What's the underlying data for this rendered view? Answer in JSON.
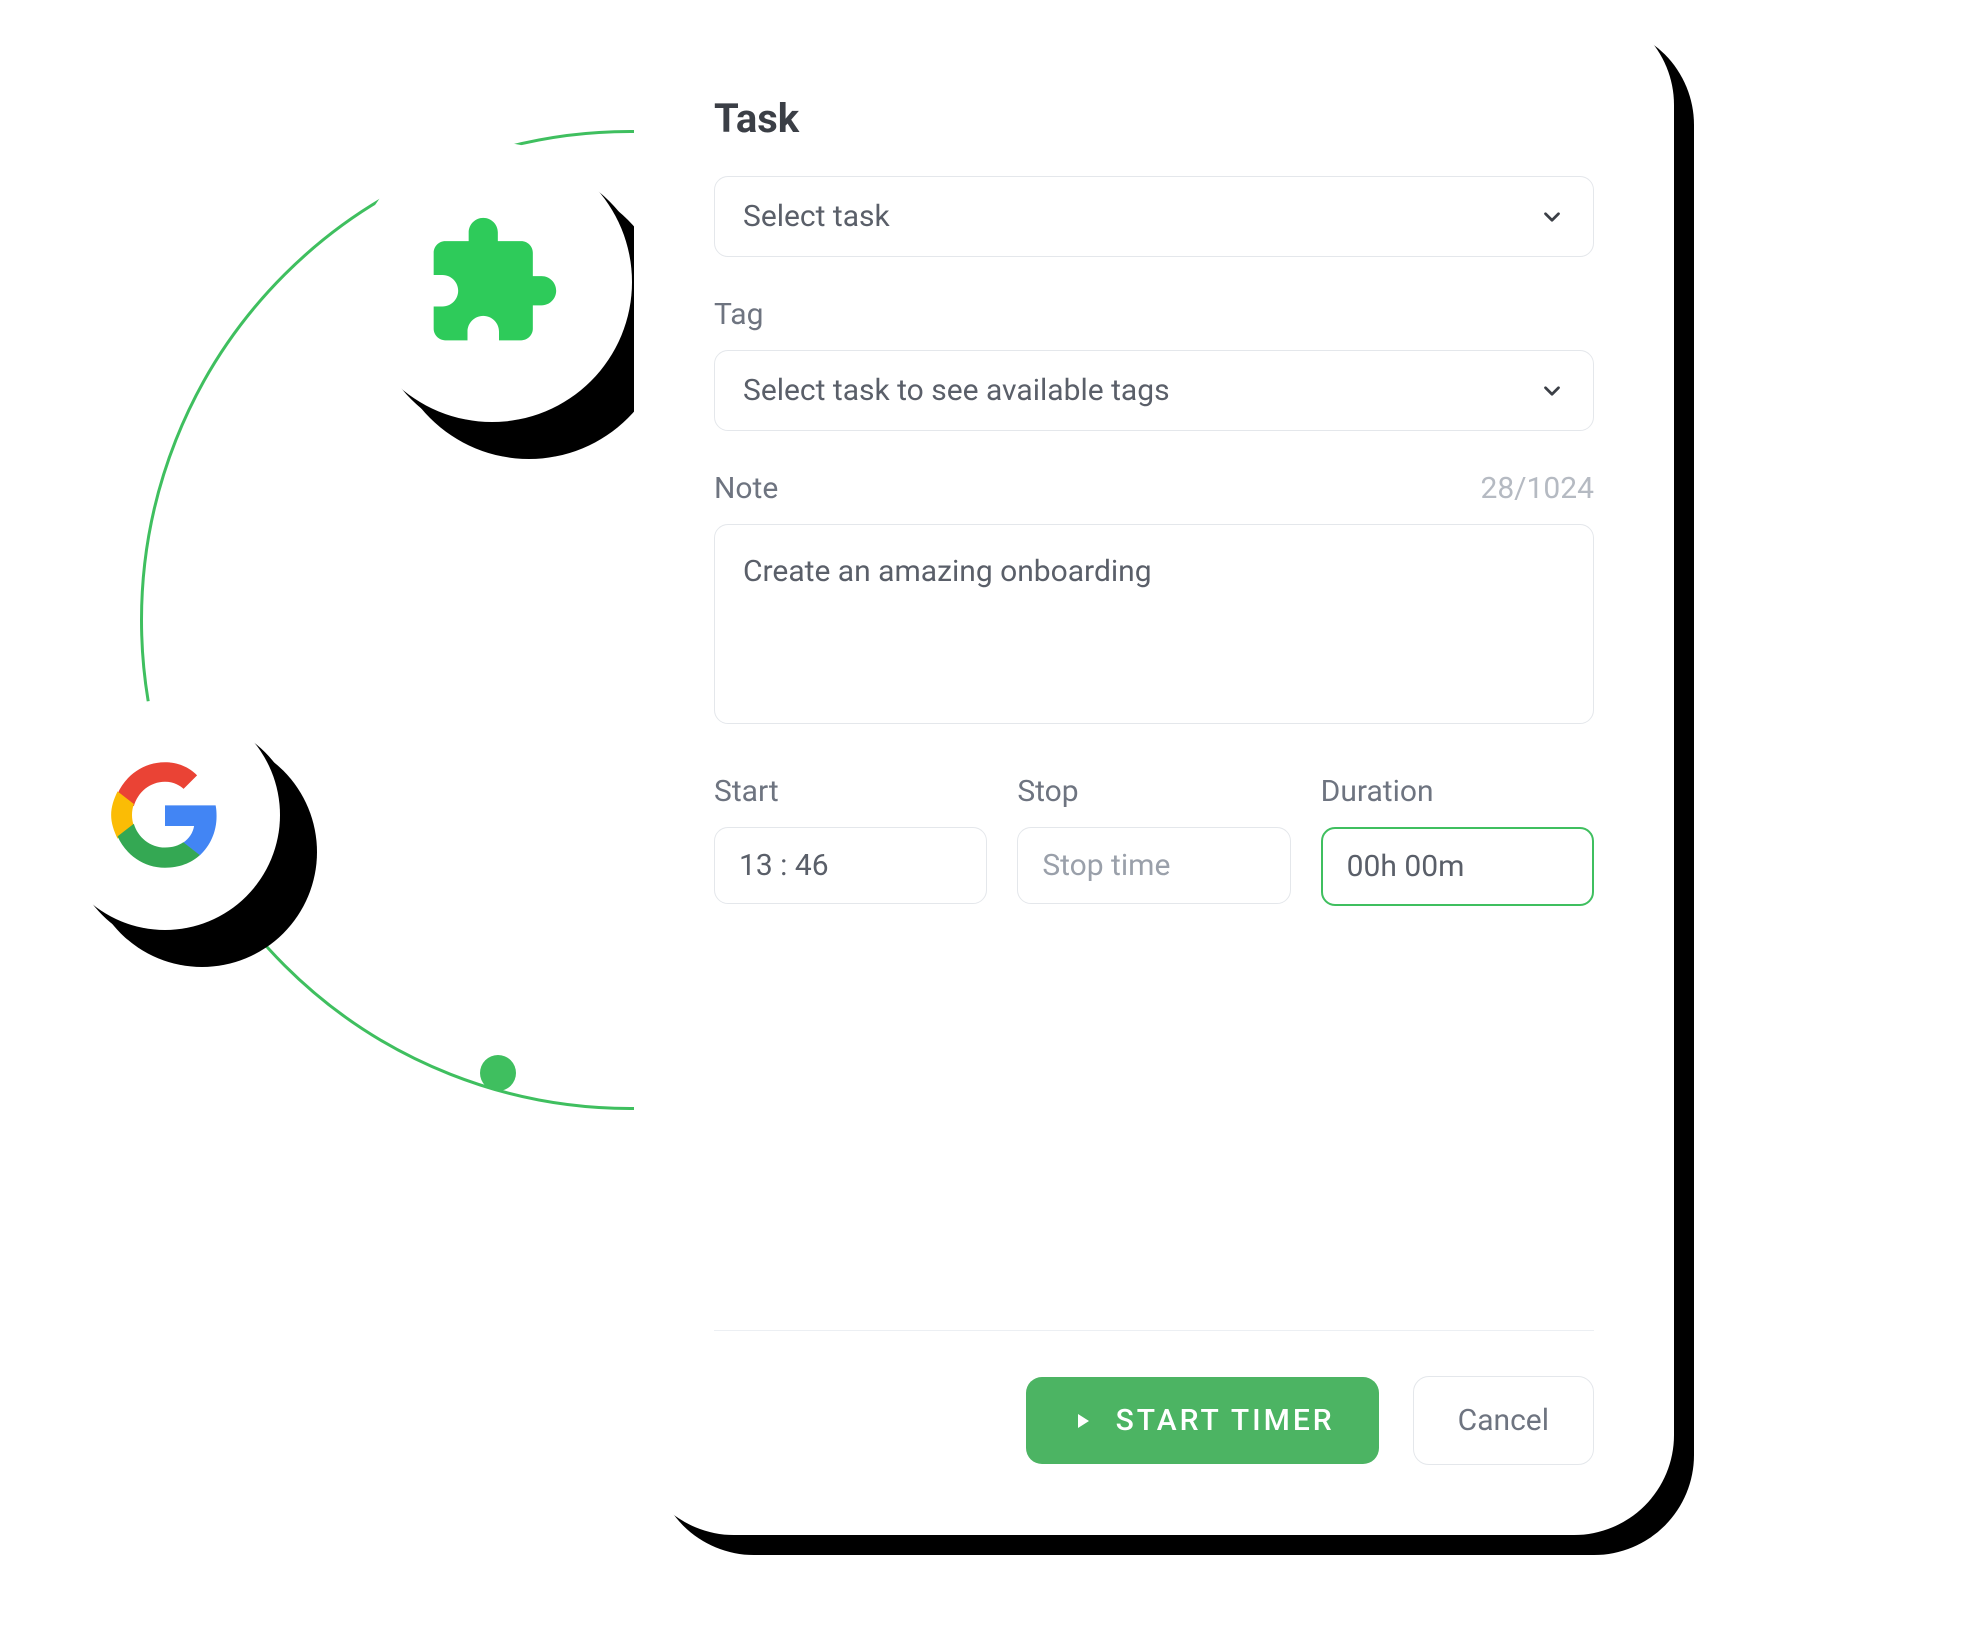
{
  "card": {
    "title": "Task",
    "task_select_placeholder": "Select task",
    "tag_label": "Tag",
    "tag_select_placeholder": "Select task to see available tags",
    "note_label": "Note",
    "note_counter": "28/1024",
    "note_value": "Create an amazing onboarding",
    "start_label": "Start",
    "start_value": "13  :  46",
    "stop_label": "Stop",
    "stop_placeholder": "Stop time",
    "duration_label": "Duration",
    "duration_value": "00h 00m",
    "start_timer_button": "START TIMER",
    "cancel_button": "Cancel"
  },
  "icons": {
    "puzzle": "puzzle-icon",
    "google": "google-icon",
    "chevron_down": "chevron-down-icon",
    "play": "play-icon"
  },
  "colors": {
    "accent": "#3fbf5f",
    "primary_button": "#4cb463",
    "text_dark": "#3b3f46",
    "text_muted": "#6e7480",
    "border": "#e4e7eb"
  }
}
